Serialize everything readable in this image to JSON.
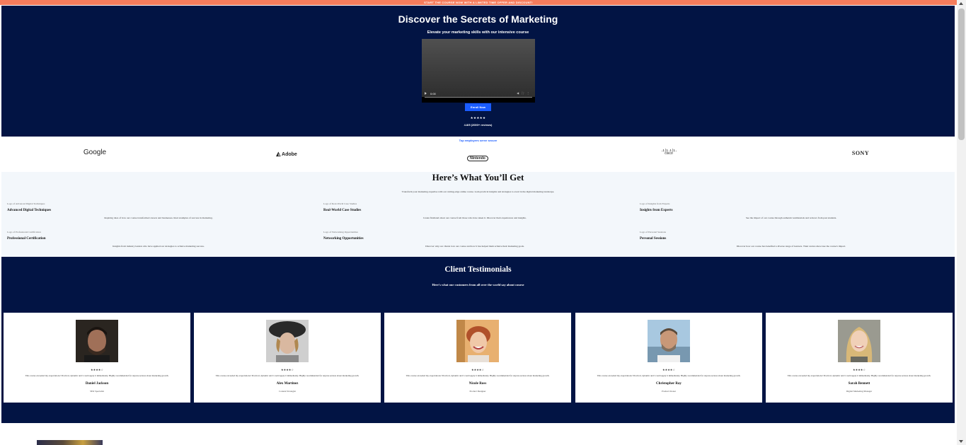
{
  "announcement": "START THE COURSE NOW WITH A LIMITED TIME OFFER AND DISCOUNT!",
  "hero": {
    "title": "Discover the Secrets of Marketing",
    "subtitle": "Elevate your marketing skills with our intensive course",
    "video_time": "0:00",
    "enroll_label": "Enroll Now",
    "stars": "★★★★★",
    "rating_text": "4.8/5 (2000+ reviews)"
  },
  "logos": {
    "trusted_text": "Top employers serve secure",
    "items": [
      "Google",
      "Adobe",
      "Nintendo",
      "cisco",
      "SONY"
    ]
  },
  "features": {
    "title": "Here’s What You’ll Get",
    "intro": "Transform your marketing expertise with our cutting-edge online course. Gain practical insights and strategies to excel in the digital marketing landscape.",
    "items": [
      {
        "img_alt": "Logo of Advanced Digital Techniques",
        "name": "Advanced Digital Techniques",
        "desc": "Inspiring tales of how our course transformed careers and businesses. Real examples of success in marketing."
      },
      {
        "img_alt": "Logo of Real-World Case Studies",
        "name": "Real-World Case Studies",
        "desc": "Listen firsthand about our course from those who have taken it. Discover their experiences and insights."
      },
      {
        "img_alt": "Logo of Insights from Experts",
        "name": "Insights from Experts",
        "desc": "See the impact of our course through authentic testimonials and reviews from past students."
      },
      {
        "img_alt": "Logo of Professional Certification",
        "name": "Professional Certification",
        "desc": "Insights from industry leaders who have applied our strategies to achieve marketing success."
      },
      {
        "img_alt": "Logo of Networking Opportunities",
        "name": "Networking Opportunities",
        "desc": "Discover why our clients love our course and how it has helped them achieve their marketing goals."
      },
      {
        "img_alt": "Logo of Personal Sessions",
        "name": "Personal Sessions",
        "desc": "Discover how our course has benefited a diverse range of learners. Their stories showcase the course's impact."
      }
    ]
  },
  "testimonials": {
    "title": "Client Testimonials",
    "subtitle": "Here's what our customers from all over the world say about course",
    "quote": "This course exceeded my expectations! Practical, dynamic and I could apply it immediately. Highly recommended for anyone serious about marketing growth.",
    "cards": [
      {
        "stars": "★★★★☆",
        "name": "Daniel Jackson",
        "role": "SEO Specialist"
      },
      {
        "stars": "★★★★☆",
        "name": "Alex Martinez",
        "role": "Content Strategist"
      },
      {
        "stars": "★★★★☆",
        "name": "Nicole Ross",
        "role": "Product Designer"
      },
      {
        "stars": "★★★★☆",
        "name": "Christopher Ray",
        "role": "Product Owner"
      },
      {
        "stars": "★★★★☆",
        "name": "Sarah Bennett",
        "role": "Digital Marketing Manager"
      }
    ]
  }
}
